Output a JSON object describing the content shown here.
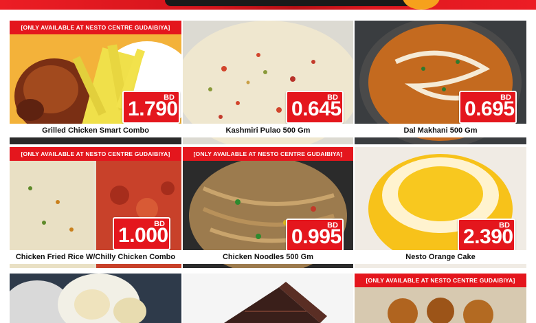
{
  "banner_text": "[ONLY AVAILABLE AT NESTO CENTRE GUDAIBIYA]",
  "currency": "BD",
  "products": [
    {
      "name": "Grilled Chicken Smart Combo",
      "price_main": "1",
      "price_dec": ".790"
    },
    {
      "name": "Kashmiri Pulao 500 Gm",
      "price_main": "0",
      "price_dec": ".645"
    },
    {
      "name": "Dal Makhani 500 Gm",
      "price_main": "0",
      "price_dec": ".695"
    },
    {
      "name": "Chicken Fried Rice W/Chilly Chicken Combo",
      "price_main": "1",
      "price_dec": ".000"
    },
    {
      "name": "Chicken Noodles 500 Gm",
      "price_main": "0",
      "price_dec": ".995"
    },
    {
      "name": "Nesto Orange Cake",
      "price_main": "2",
      "price_dec": ".390"
    }
  ],
  "colors": {
    "brand_red": "#e4161d",
    "accent_orange": "#f6a11c"
  }
}
